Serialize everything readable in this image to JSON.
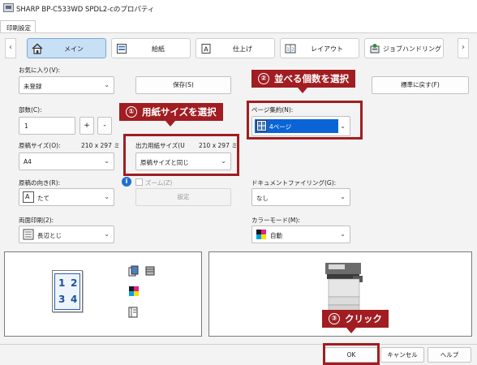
{
  "window": {
    "title": "SHARP BP-C533WD SPDL2-cのプロパティ"
  },
  "tabs": [
    {
      "label": "印刷設定"
    }
  ],
  "toolbar": {
    "tabs": [
      {
        "label": "メイン",
        "icon": "home-icon"
      },
      {
        "label": "給紙",
        "icon": "paper-tray-icon"
      },
      {
        "label": "仕上げ",
        "icon": "finishing-icon"
      },
      {
        "label": "レイアウト",
        "icon": "layout-icon"
      },
      {
        "label": "ジョブハンドリング",
        "icon": "job-handling-icon"
      }
    ]
  },
  "favorites": {
    "label": "お気に入り(V):",
    "value": "未登録",
    "save_label": "保存(S)",
    "default_label": "標準に戻す(F)"
  },
  "copies": {
    "label": "部数(C):",
    "value": "1",
    "plus": "+",
    "minus": "-"
  },
  "original_size": {
    "label": "原稿サイズ(O):",
    "dims": "210 x 297 ミ",
    "value": "A4"
  },
  "output_size": {
    "label": "出力用紙サイズ(U",
    "dims": "210 x 297 ミ",
    "value": "原稿サイズと同じ"
  },
  "zoom": {
    "label": "ズーム(Z)",
    "settings_label": "設定"
  },
  "orientation": {
    "label": "原稿の向き(R):",
    "value": "たて"
  },
  "duplex": {
    "label": "両面印刷(2):",
    "value": "長辺とじ"
  },
  "n_up": {
    "label": "ページ集約(N):",
    "value": "4ページ"
  },
  "document_filing": {
    "label": "ドキュメントファイリング(G):",
    "value": "なし"
  },
  "color_mode": {
    "label": "カラーモード(M):",
    "value": "自動"
  },
  "callouts": [
    {
      "num": "①",
      "text": "用紙サイズを選択"
    },
    {
      "num": "②",
      "text": "並べる個数を選択"
    },
    {
      "num": "③",
      "text": "クリック"
    }
  ],
  "preview": {
    "pages": [
      "1",
      "2",
      "3",
      "4"
    ]
  },
  "footer": {
    "ok_label": "OK",
    "cancel_label": "キャンセル",
    "help_label": "ヘルプ"
  },
  "colors": {
    "accent": "#a11d21",
    "selection": "#0a64d6",
    "active_tab": "#c8e0f5"
  }
}
